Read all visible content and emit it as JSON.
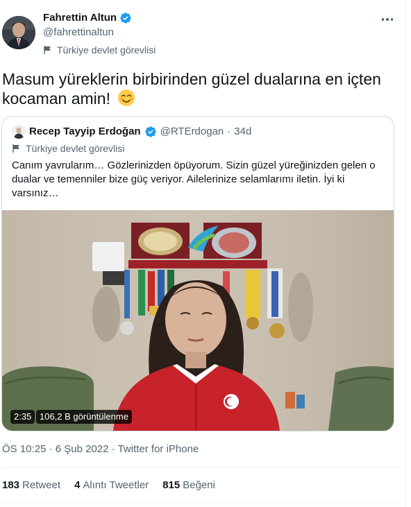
{
  "author": {
    "display_name": "Fahrettin Altun",
    "handle": "@fahrettinaltun",
    "label": "Türkiye devlet görevlisi",
    "verified": true
  },
  "tweet": {
    "text_line1": "Masum yüreklerin birbirinden güzel dualarına en içten",
    "text_line2": "kocaman amin!",
    "emoji": "smiling-face-with-smiling-eyes"
  },
  "quoted_tweet": {
    "display_name": "Recep Tayyip Erdoğan",
    "handle": "@RTErdogan",
    "separator": "·",
    "age": "34d",
    "label": "Türkiye devlet görevlisi",
    "text": "Canım yavrularım… Gözlerinizden öpüyorum. Sizin güzel yüreğinizden gelen o dualar ve temenniler bize güç veriyor. Ailelerinize selamlarımı iletin. İyi ki varsınız…",
    "video": {
      "duration": "2:35",
      "views": "106,2 B görüntülenme"
    }
  },
  "meta": {
    "time": "ÖS 10:25",
    "separator1": "·",
    "date": "6 Şub 2022",
    "separator2": "·",
    "source": "Twitter for iPhone"
  },
  "stats": {
    "retweets_count": "183",
    "retweets_label": "Retweet",
    "quotes_count": "4",
    "quotes_label": "Alıntı Tweetler",
    "likes_count": "815",
    "likes_label": "Beğeni"
  },
  "colors": {
    "verified": "#1d9bf0",
    "text_primary": "#0f1419",
    "text_secondary": "#536471",
    "border": "#cfd9de"
  }
}
